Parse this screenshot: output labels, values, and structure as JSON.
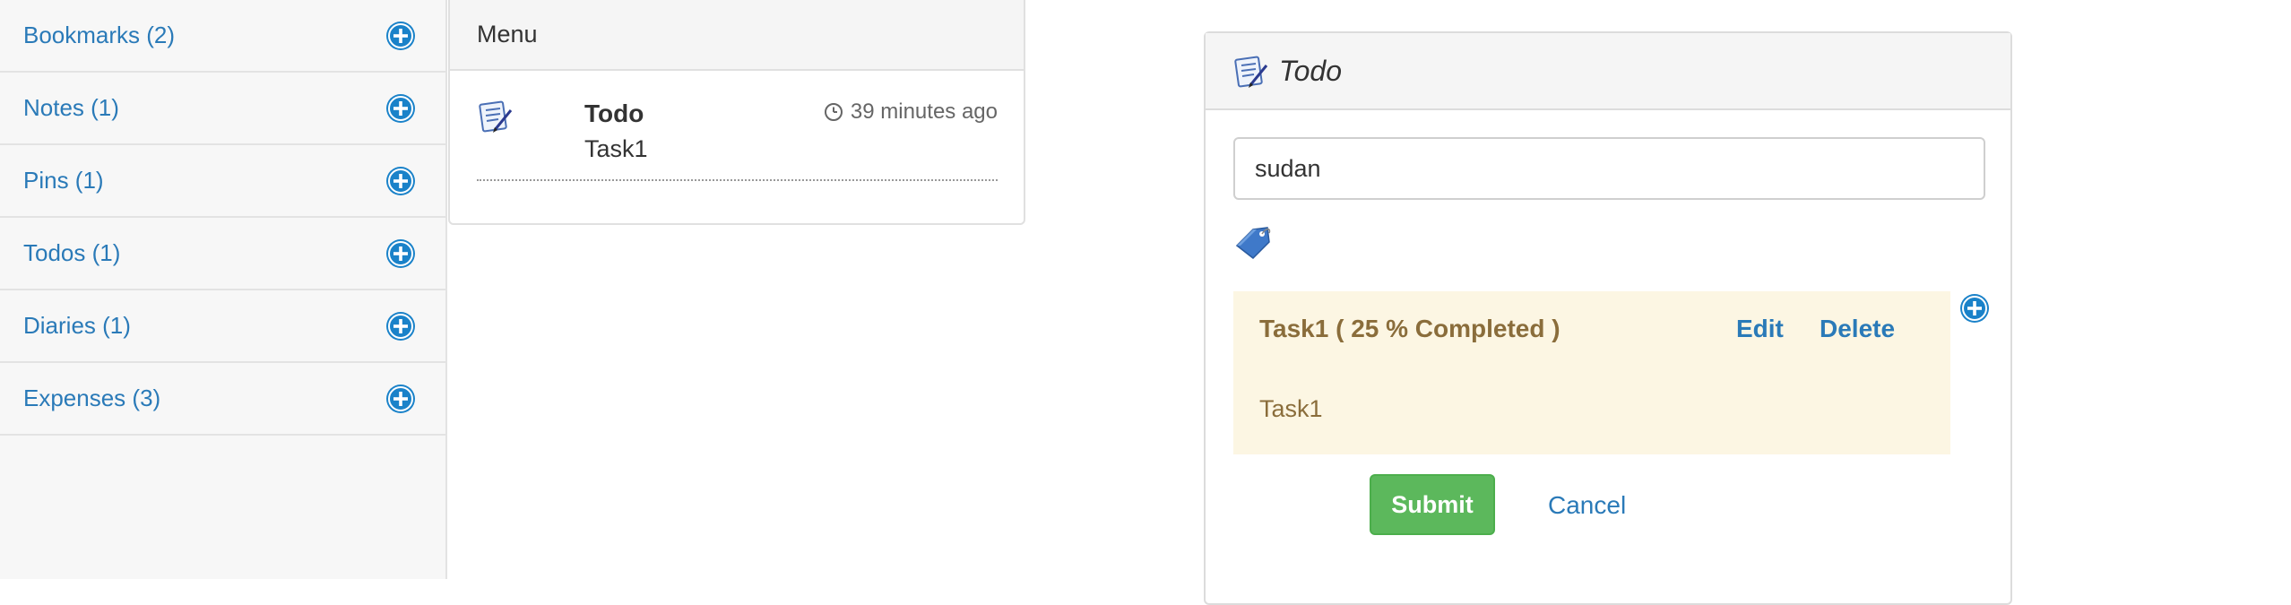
{
  "sidebar": {
    "items": [
      {
        "label": "Bookmarks (2)"
      },
      {
        "label": "Notes (1)"
      },
      {
        "label": "Pins (1)"
      },
      {
        "label": "Todos (1)"
      },
      {
        "label": "Diaries (1)"
      },
      {
        "label": "Expenses (3)"
      }
    ],
    "add_icon": "plus-circle-icon"
  },
  "menu": {
    "title": "Menu",
    "entries": [
      {
        "icon": "todo-notepad-icon",
        "title": "Todo",
        "subtitle": "Task1",
        "time": "39 minutes ago",
        "time_icon": "clock-icon"
      }
    ]
  },
  "todo_form": {
    "title": "Todo",
    "title_icon": "todo-notepad-icon",
    "name_value": "sudan",
    "tag_icon": "tag-icon",
    "task": {
      "heading": "Task1 ( 25 % Completed )",
      "edit_label": "Edit",
      "delete_label": "Delete",
      "body": "Task1",
      "completed_percent": 25
    },
    "add_task_icon": "plus-circle-icon",
    "submit_label": "Submit",
    "cancel_label": "Cancel"
  },
  "colors": {
    "link": "#2a7ab8",
    "success": "#5cb85c",
    "warning_bg": "#fcf6e3",
    "warning_text": "#8a6d3b"
  }
}
